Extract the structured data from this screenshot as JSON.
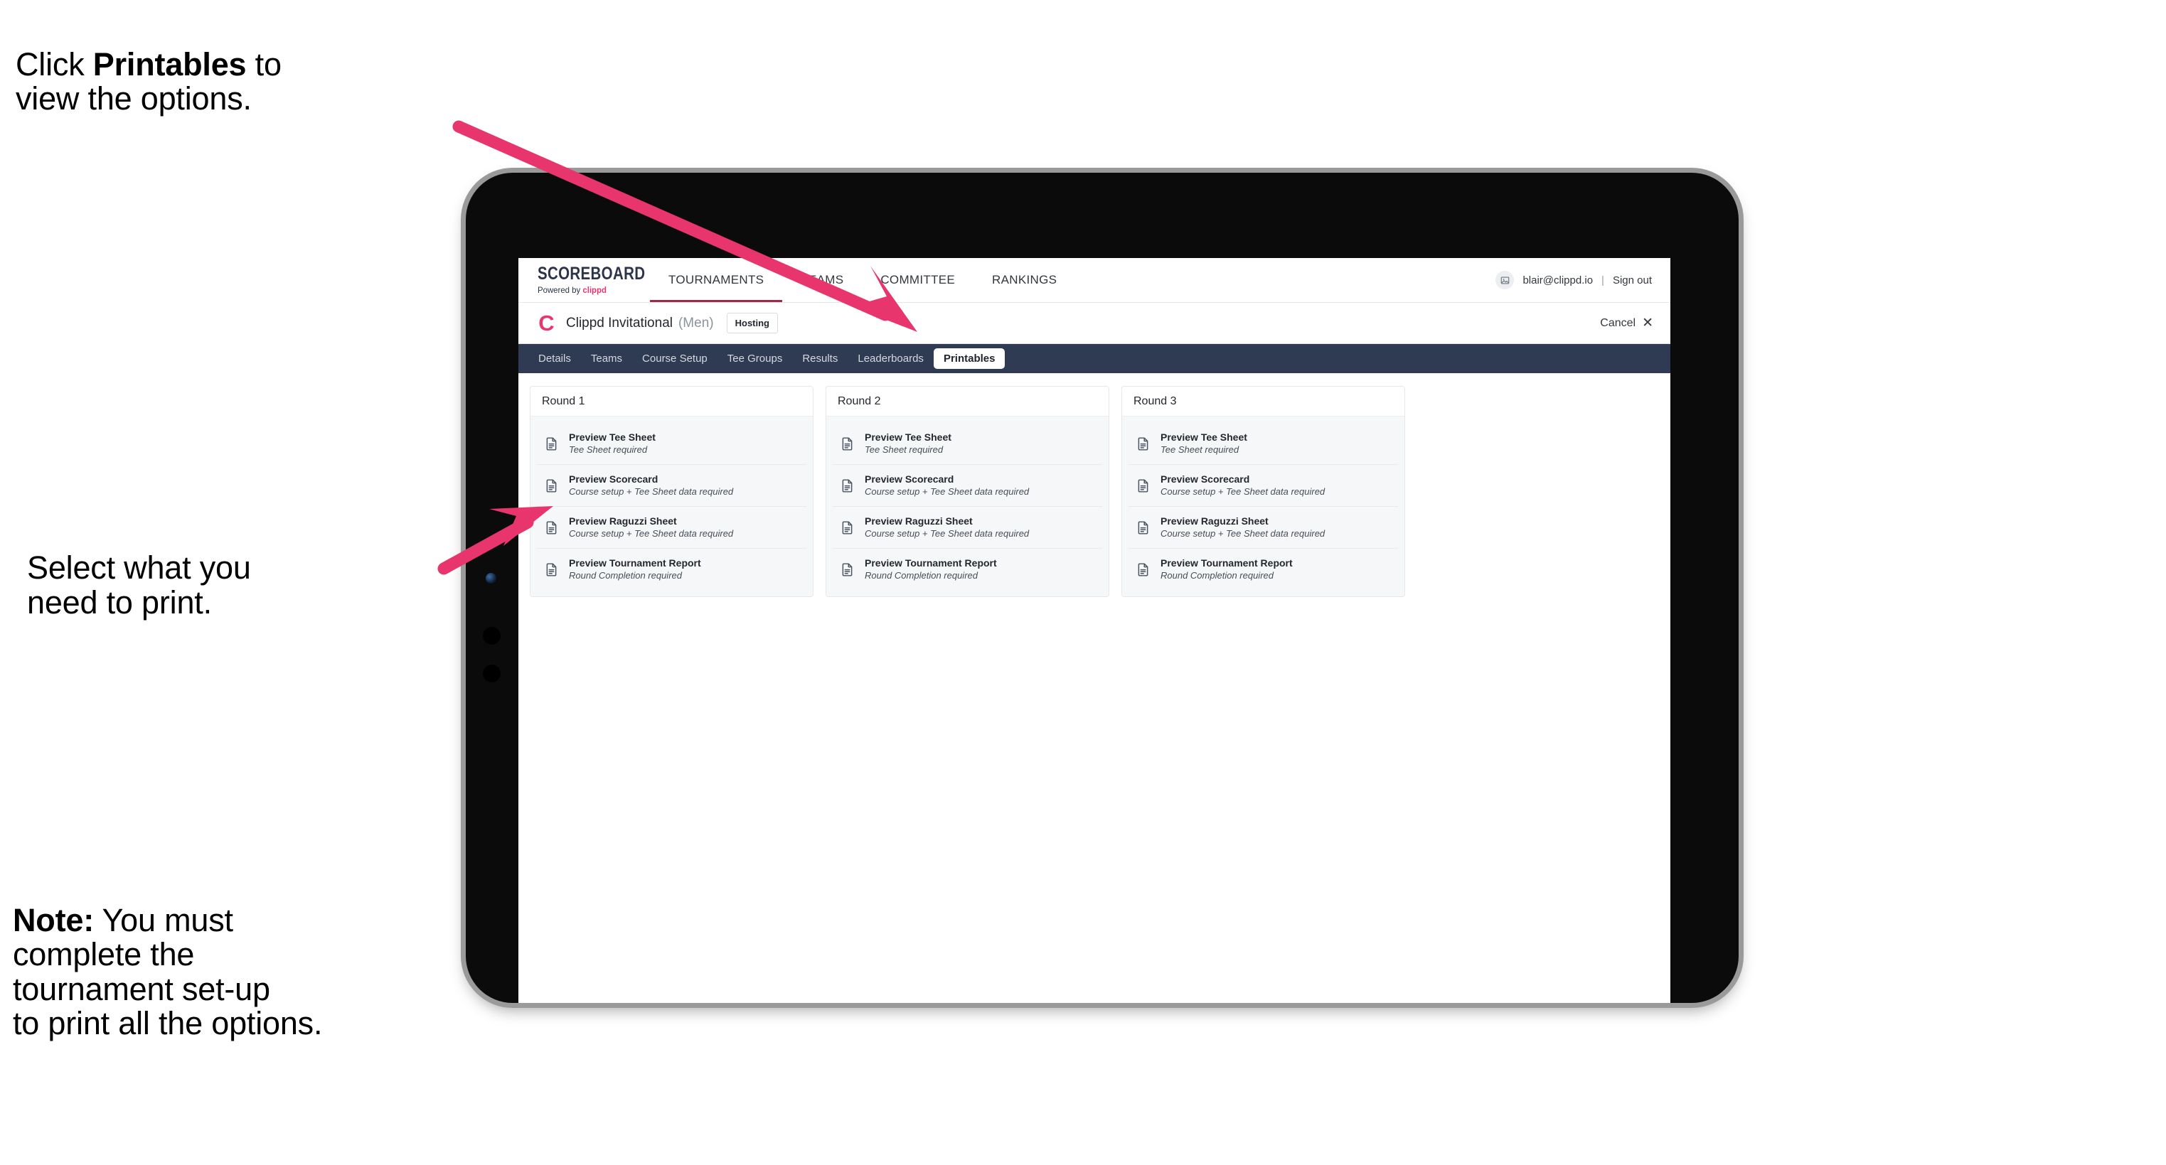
{
  "annotations": {
    "click_printables": {
      "prefix": "Click ",
      "bold": "Printables",
      "suffix": " to\nview the options."
    },
    "select_print": "Select what you\n need to print.",
    "note": {
      "bold": "Note:",
      "text": " You must\ncomplete the\ntournament set-up\nto print all the options."
    }
  },
  "colors": {
    "accent_pink": "#e8356d",
    "arrow_pink": "#e8356d",
    "tabbar_navy": "#2f3b52",
    "topnav_active_underline": "#9e2b45",
    "panel_gray": "#f6f7f8",
    "bezel_black": "#0b0b0b",
    "bezel_silver": "#9a9a9a"
  },
  "app": {
    "brand": {
      "title": "SCOREBOARD",
      "powered_prefix": "Powered by ",
      "powered_brand": "clippd"
    },
    "topnav": [
      {
        "label": "TOURNAMENTS",
        "active": true
      },
      {
        "label": "TEAMS",
        "active": false
      },
      {
        "label": "COMMITTEE",
        "active": false
      },
      {
        "label": "RANKINGS",
        "active": false
      }
    ],
    "account": {
      "avatar_icon": "user-image-icon",
      "email": "blair@clippd.io",
      "separator": "|",
      "sign_out": "Sign out"
    },
    "tournament": {
      "logo_letter": "C",
      "name": "Clippd Invitational",
      "gender": "(Men)",
      "badge": "Hosting",
      "cancel_label": "Cancel",
      "cancel_icon": "close-icon"
    },
    "tabs": [
      {
        "label": "Details",
        "active": false
      },
      {
        "label": "Teams",
        "active": false
      },
      {
        "label": "Course Setup",
        "active": false
      },
      {
        "label": "Tee Groups",
        "active": false
      },
      {
        "label": "Results",
        "active": false
      },
      {
        "label": "Leaderboards",
        "active": false
      },
      {
        "label": "Printables",
        "active": true
      }
    ],
    "rounds": [
      {
        "title": "Round 1",
        "items": [
          {
            "icon": "document-icon",
            "title": "Preview Tee Sheet",
            "subtitle": "Tee Sheet required"
          },
          {
            "icon": "document-icon",
            "title": "Preview Scorecard",
            "subtitle": "Course setup + Tee Sheet data required"
          },
          {
            "icon": "document-icon",
            "title": "Preview Raguzzi Sheet",
            "subtitle": "Course setup + Tee Sheet data required"
          },
          {
            "icon": "document-icon",
            "title": "Preview Tournament Report",
            "subtitle": "Round Completion required"
          }
        ]
      },
      {
        "title": "Round 2",
        "items": [
          {
            "icon": "document-icon",
            "title": "Preview Tee Sheet",
            "subtitle": "Tee Sheet required"
          },
          {
            "icon": "document-icon",
            "title": "Preview Scorecard",
            "subtitle": "Course setup + Tee Sheet data required"
          },
          {
            "icon": "document-icon",
            "title": "Preview Raguzzi Sheet",
            "subtitle": "Course setup + Tee Sheet data required"
          },
          {
            "icon": "document-icon",
            "title": "Preview Tournament Report",
            "subtitle": "Round Completion required"
          }
        ]
      },
      {
        "title": "Round 3",
        "items": [
          {
            "icon": "document-icon",
            "title": "Preview Tee Sheet",
            "subtitle": "Tee Sheet required"
          },
          {
            "icon": "document-icon",
            "title": "Preview Scorecard",
            "subtitle": "Course setup + Tee Sheet data required"
          },
          {
            "icon": "document-icon",
            "title": "Preview Raguzzi Sheet",
            "subtitle": "Course setup + Tee Sheet data required"
          },
          {
            "icon": "document-icon",
            "title": "Preview Tournament Report",
            "subtitle": "Round Completion required"
          }
        ]
      }
    ]
  }
}
